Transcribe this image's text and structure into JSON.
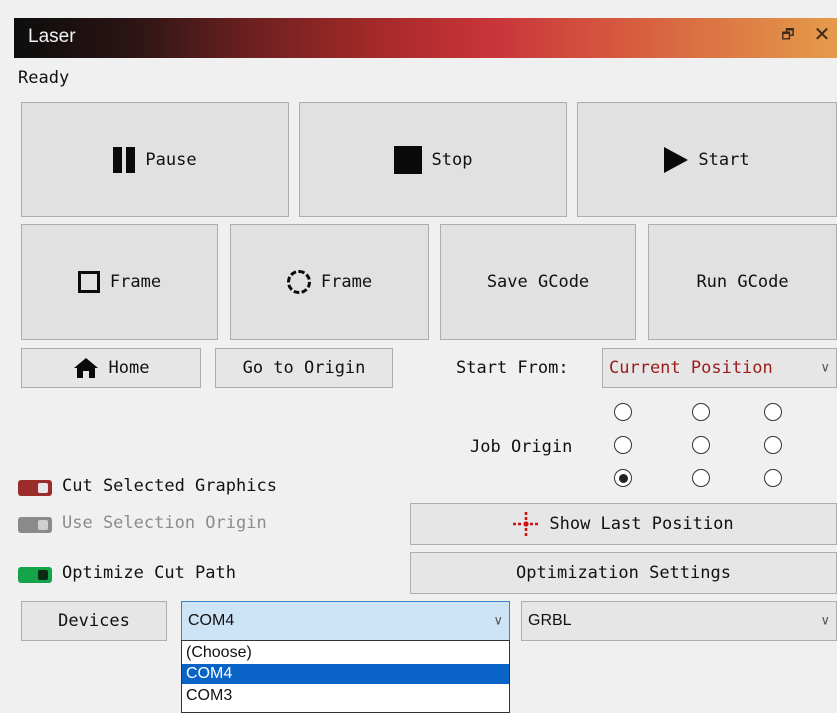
{
  "window": {
    "title": "Laser",
    "restore_glyph": "🗗",
    "close_glyph": "✕"
  },
  "status": "Ready",
  "controls": {
    "pause": "Pause",
    "stop": "Stop",
    "start": "Start",
    "frame_rect": "Frame",
    "frame_circle": "Frame",
    "save_gcode": "Save GCode",
    "run_gcode": "Run GCode",
    "home": "Home",
    "go_to_origin": "Go to Origin"
  },
  "start_from": {
    "label": "Start From:",
    "value": "Current Position",
    "value_color": "#9a1c1c"
  },
  "job_origin": {
    "label": "Job Origin",
    "selected": "bottom-left"
  },
  "options": {
    "cut_selected": {
      "label": "Cut Selected Graphics",
      "state": "off"
    },
    "use_selection_origin": {
      "label": "Use Selection Origin",
      "state": "disabled"
    },
    "optimize_cut_path": {
      "label": "Optimize Cut Path",
      "state": "on"
    }
  },
  "show_last_position": "Show Last Position",
  "optimization_settings": "Optimization Settings",
  "devices": {
    "button": "Devices",
    "port": "COM4",
    "controller": "GRBL",
    "port_options": [
      "(Choose)",
      "COM4",
      "COM3"
    ],
    "selected_option": "COM4"
  }
}
